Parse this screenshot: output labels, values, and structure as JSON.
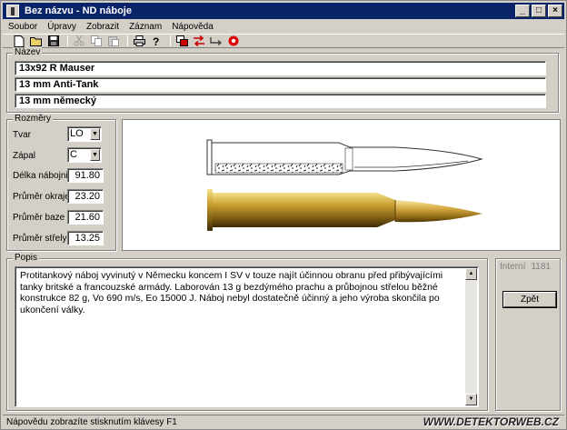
{
  "window": {
    "title": "Bez názvu - ND náboje",
    "controls": [
      "_",
      "□",
      "×"
    ]
  },
  "menu": [
    "Soubor",
    "Úpravy",
    "Zobrazit",
    "Záznam",
    "Nápověda"
  ],
  "toolbar": {
    "icons": [
      "new-icon",
      "open-icon",
      "save-icon",
      "cut-icon",
      "copy-icon",
      "paste-icon",
      "print-icon",
      "help-icon",
      "window-icon",
      "swap-icon",
      "link-icon",
      "stop-icon"
    ]
  },
  "names": {
    "legend": "Název",
    "fields": [
      "13x92 R Mauser",
      "13 mm Anti-Tank",
      "13 mm německý"
    ]
  },
  "dimensions": {
    "legend": "Rozměry",
    "tvar_label": "Tvar",
    "tvar_value": "LO",
    "zapal_label": "Zápal",
    "zapal_value": "C",
    "rows": [
      {
        "label": "Délka nábojnice",
        "value": "91.80"
      },
      {
        "label": "Průměr okraje",
        "value": "23.20"
      },
      {
        "label": "Průměr baze",
        "value": "21.60"
      },
      {
        "label": "Průměr střely",
        "value": "13.25"
      }
    ]
  },
  "description": {
    "legend": "Popis",
    "text": "Protitankový náboj vyvinutý v Německu koncem I SV v touze najít účinnou obranu před přibývajícími tanky britské a francouzské armády. Laborován 13 g bezdýmého prachu a průbojnou střelou běžné konstrukce 82 g, Vo 690 m/s, Eo 15000 J. Náboj nebyl dostatečně účinný a jeho výroba skončila po ukončení války."
  },
  "side": {
    "internal_label": "Interní",
    "internal_value": "1181",
    "back_button": "Zpět"
  },
  "status": "Nápovědu zobrazíte stisknutím klávesy F1",
  "watermark": "WWW.DETEKTORWEB.CZ"
}
